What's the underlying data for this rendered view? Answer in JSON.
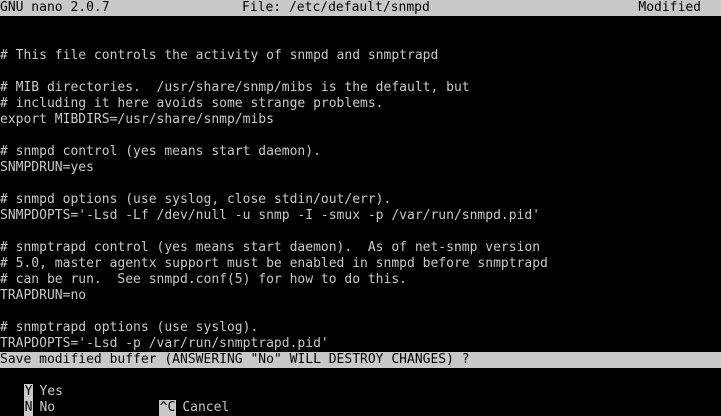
{
  "titlebar": {
    "app": "GNU nano 2.0.7",
    "file": "File: /etc/default/snmpd",
    "status": "Modified"
  },
  "content_lines": [
    "",
    "# This file controls the activity of snmpd and snmptrapd",
    "",
    "# MIB directories.  /usr/share/snmp/mibs is the default, but",
    "# including it here avoids some strange problems.",
    "export MIBDIRS=/usr/share/snmp/mibs",
    "",
    "# snmpd control (yes means start daemon).",
    "SNMPDRUN=yes",
    "",
    "# snmpd options (use syslog, close stdin/out/err).",
    "SNMPDOPTS='-Lsd -Lf /dev/null -u snmp -I -smux -p /var/run/snmpd.pid'",
    "",
    "# snmptrapd control (yes means start daemon).  As of net-snmp version",
    "# 5.0, master agentx support must be enabled in snmpd before snmptrapd",
    "# can be run.  See snmpd.conf(5) for how to do this.",
    "TRAPDRUN=no",
    "",
    "# snmptrapd options (use syslog).",
    "TRAPDOPTS='-Lsd -p /var/run/snmptrapd.pid'"
  ],
  "prompt": "Save modified buffer (ANSWERING \"No\" WILL DESTROY CHANGES) ?",
  "options": {
    "yes": {
      "key": "Y",
      "label": "Yes"
    },
    "no": {
      "key": "N",
      "label": "No"
    },
    "cancel": {
      "key": "^C",
      "label": "Cancel"
    }
  },
  "colors": {
    "background": "#000000",
    "foreground": "#c8c8c8",
    "inverse_bg": "#c8c8c8",
    "inverse_fg": "#000000"
  }
}
